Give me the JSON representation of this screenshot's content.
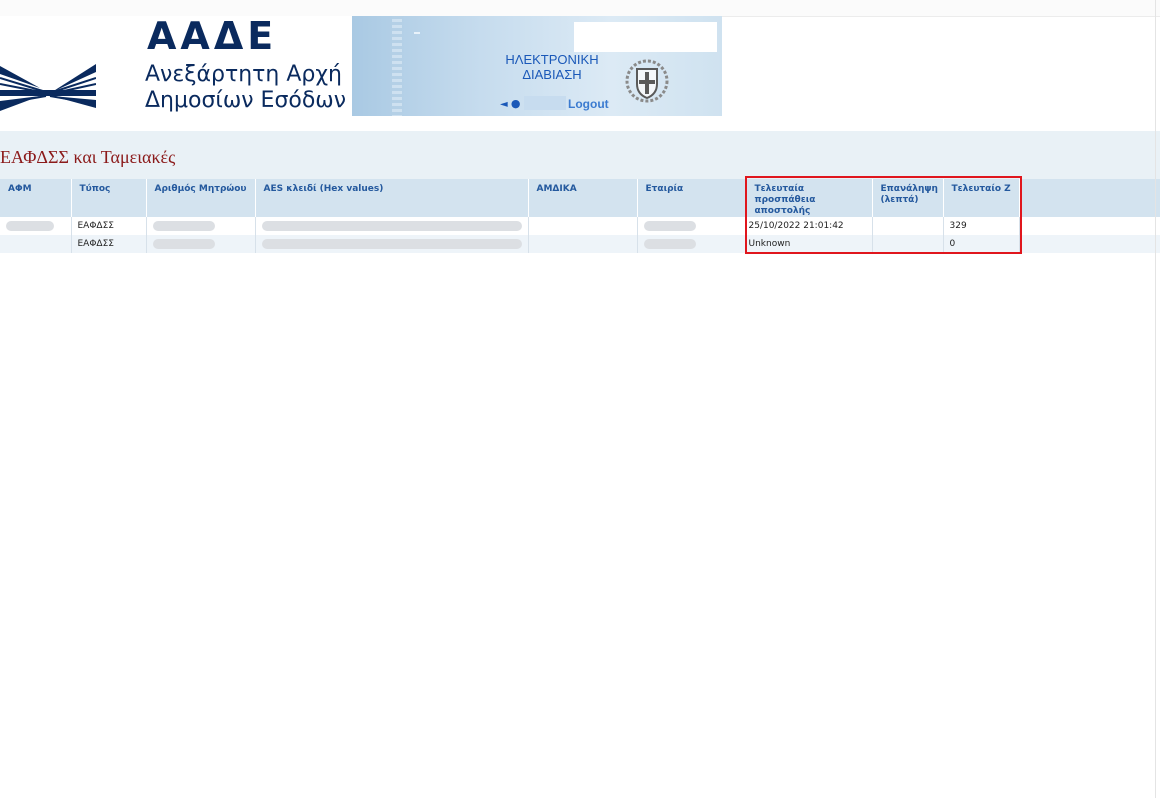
{
  "header": {
    "logo_acronym": "ΑΑΔΕ",
    "logo_line1": "Ανεξάρτητη Αρχή",
    "logo_line2": "Δημοσίων Εσόδων",
    "service_title": "ΗΛΕΚΤΡΟΝΙΚΗ ΔΙΑΒΙΑΣΗ",
    "logout_label": "Logout"
  },
  "page": {
    "title": "ΕΑΦΔΣΣ και Ταμειακές"
  },
  "table": {
    "columns": [
      "ΑΦΜ",
      "Τύπος",
      "Αριθμός Μητρώου",
      "AES κλειδί (Hex values)",
      "ΑΜΔΙΚΑ",
      "Εταιρία",
      "Τελευταία προσπάθεια αποστολής",
      "Επανάληψη (λεπτά)",
      "Τελευταίο Ζ",
      ""
    ],
    "rows": [
      {
        "afm": "",
        "type": "ΕΑΦΔΣΣ",
        "registry_no": "",
        "aes_key": "",
        "amdika": "",
        "company": "",
        "last_attempt": "25/10/2022 21:01:42",
        "retry_minutes": "",
        "last_z": "329"
      },
      {
        "afm": "",
        "type": "ΕΑΦΔΣΣ",
        "registry_no": "",
        "aes_key": "",
        "amdika": "",
        "company": "",
        "last_attempt": "Unknown",
        "retry_minutes": "",
        "last_z": "0"
      }
    ]
  },
  "colors": {
    "title": "#8b1a1a",
    "header_bg": "#d3e3ef",
    "header_text": "#24599e",
    "highlight": "#e0161d",
    "brand": "#0a2a5e"
  },
  "icons": {
    "logo": "aade-logo-icon",
    "user": "user-icon",
    "emblem": "greek-coat-of-arms-icon"
  }
}
